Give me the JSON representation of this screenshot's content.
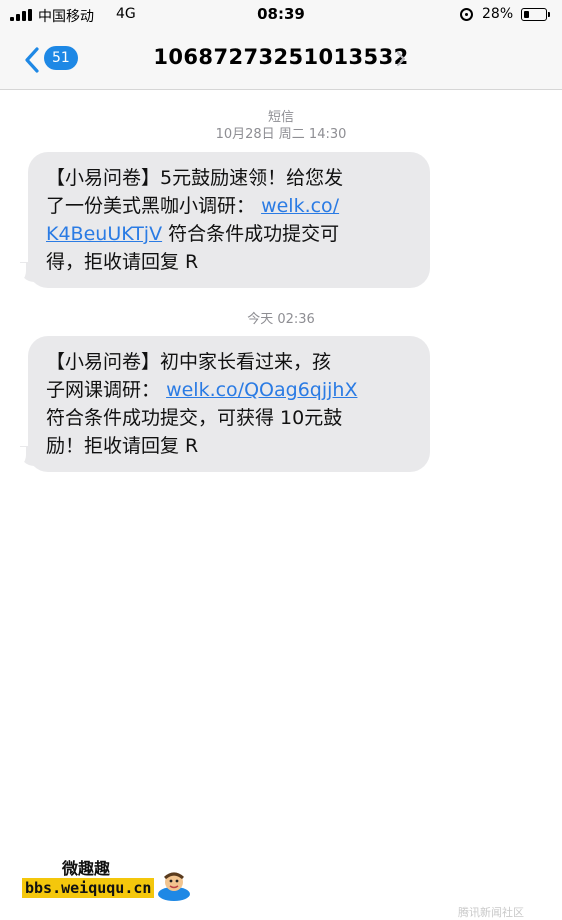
{
  "status_bar": {
    "carrier": "中国移动",
    "network": "4G",
    "time": "08:39",
    "battery_percent": "28%",
    "battery_level": 0.28,
    "icons": [
      "signal-icon",
      "orientation-lock-icon",
      "battery-icon"
    ]
  },
  "nav": {
    "back_badge": "51",
    "contact": "10687273251013532"
  },
  "conversation": {
    "service": "短信",
    "first_timestamp": "10月28日 周二 14:30",
    "second_timestamp": "今天 02:36",
    "messages": [
      {
        "lines": [
          {
            "text": "【小易问卷】5元鼓励速领！给您发"
          },
          {
            "text": "了一份美式黑咖小调研：",
            "link": "welk.co/"
          },
          {
            "text": "",
            "link": "K4BeuUKTjV",
            "suffix": " 符合条件成功提交可"
          },
          {
            "text": "得，拒收请回复 R"
          }
        ]
      },
      {
        "lines": [
          {
            "text": "【小易问卷】初中家长看过来，孩"
          },
          {
            "text": "子网课调研：",
            "link": "welk.co/QOag6qjjhX"
          },
          {
            "text": "符合条件成功提交，可获得 10元鼓"
          },
          {
            "text": "励！拒收请回复 R"
          }
        ]
      }
    ]
  },
  "watermark": {
    "title": "微趣趣",
    "url": "bbs.weiququ.cn",
    "corner": "腾讯新闻社区"
  },
  "colors": {
    "bubble": "#e9e9eb",
    "link": "#2a7be4",
    "badge": "#1e88e5",
    "meta_text": "#8e8e93"
  }
}
